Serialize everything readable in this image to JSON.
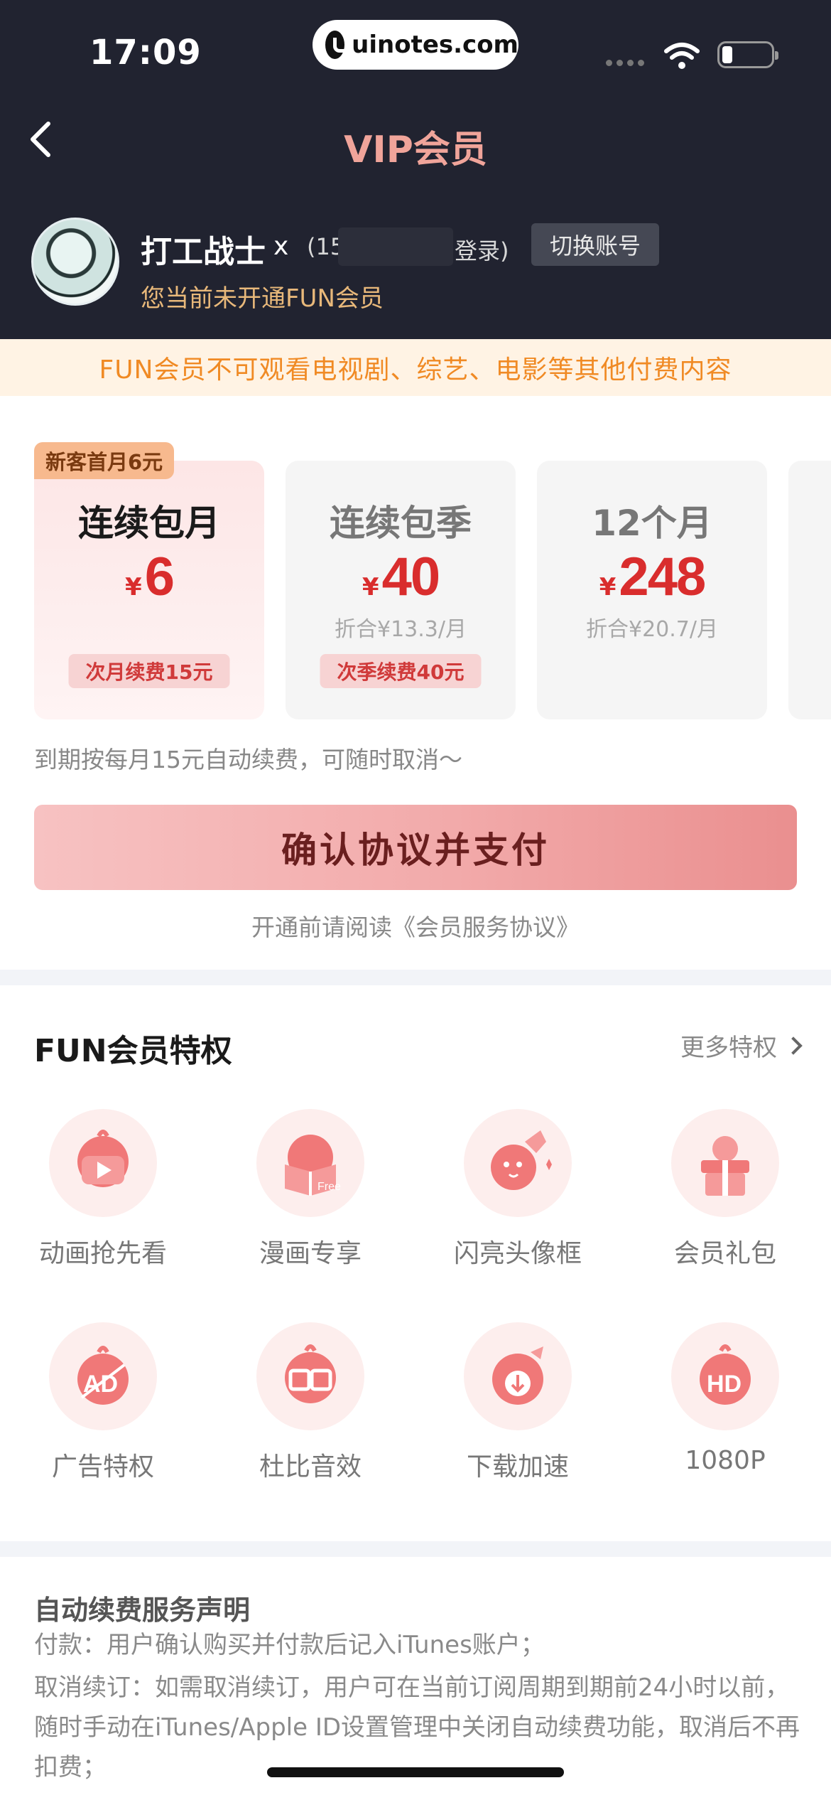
{
  "status_bar": {
    "time": "17:09",
    "url": "uinotes.com"
  },
  "nav": {
    "title": "VIP会员"
  },
  "user": {
    "name": "打工战士",
    "name_suffix": "x",
    "phone_prefix": "(15",
    "login_suffix": "登录)",
    "switch_label": "切换账号",
    "status": "您当前未开通FUN会员"
  },
  "notice": "FUN会员不可观看电视剧、综艺、电影等其他付费内容",
  "plans": [
    {
      "tag": "新客首月6元",
      "name": "连续包月",
      "currency": "¥",
      "price": "6",
      "per": "",
      "renew": "次月续费15元",
      "selected": true
    },
    {
      "name": "连续包季",
      "currency": "¥",
      "price": "40",
      "per": "折合¥13.3/月",
      "renew": "次季续费40元",
      "selected": false
    },
    {
      "name": "12个月",
      "currency": "¥",
      "price": "248",
      "per": "折合¥20.7/月",
      "renew": "",
      "selected": false
    }
  ],
  "auto_renew_note": "到期按每月15元自动续费，可随时取消～",
  "pay_button": "确认协议并支付",
  "agreement_note": "开通前请阅读《会员服务协议》",
  "privileges": {
    "title": "FUN会员特权",
    "more": "更多特权",
    "items": [
      {
        "label": "动画抢先看",
        "icon": "anime-play-icon"
      },
      {
        "label": "漫画专享",
        "icon": "comic-book-icon"
      },
      {
        "label": "闪亮头像框",
        "icon": "avatar-frame-icon"
      },
      {
        "label": "会员礼包",
        "icon": "gift-box-icon"
      },
      {
        "label": "广告特权",
        "icon": "no-ad-icon"
      },
      {
        "label": "杜比音效",
        "icon": "dolby-icon"
      },
      {
        "label": "下载加速",
        "icon": "download-icon"
      },
      {
        "label": "1080P",
        "icon": "hd-icon"
      }
    ]
  },
  "declaration": {
    "title": "自动续费服务声明",
    "p1": "付款：用户确认购买并付款后记入iTunes账户；",
    "p2": "取消续订：如需取消续订，用户可在当前订阅周期到期前24小时以前，随时手动在iTunes/Apple ID设置管理中关闭自动续费功能，取消后不再扣费；"
  },
  "colors": {
    "dark_bg": "#212330",
    "title_pink": "#f0a49a",
    "price_red": "#d92d2d",
    "notice_orange": "#f08a24"
  }
}
